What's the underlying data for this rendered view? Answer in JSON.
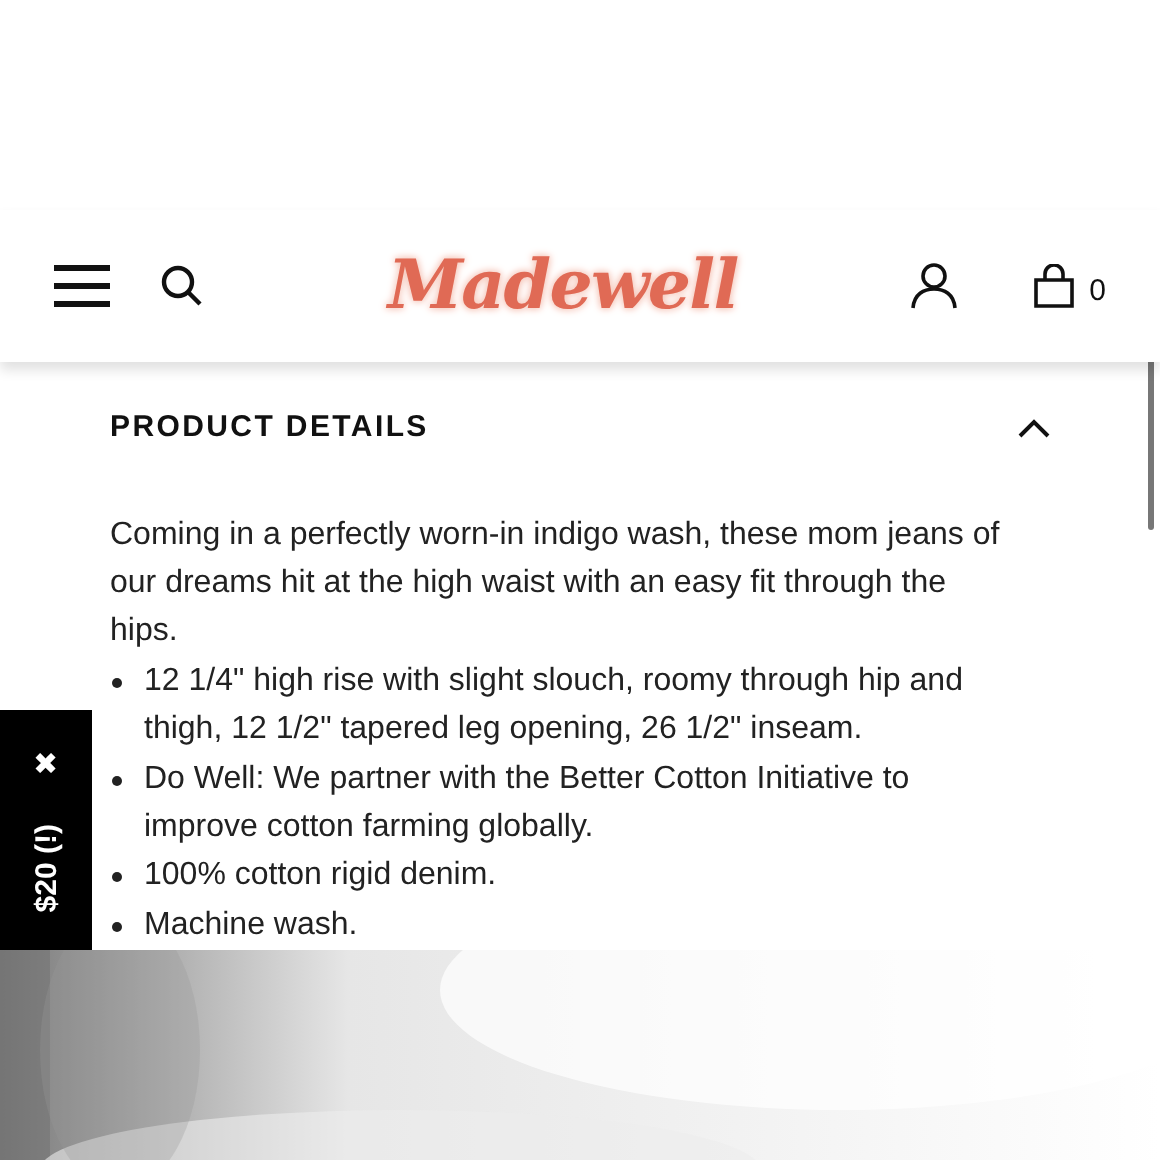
{
  "header": {
    "logo": "Madewell",
    "cart_count": "0"
  },
  "section": {
    "title": "PRODUCT DETAILS",
    "expanded": true,
    "description": "Coming in a perfectly worn-in indigo wash, these mom jeans of our dreams hit at the high waist with an easy fit through the hips.",
    "bullets": [
      "12 1/4\" high rise with slight slouch, roomy through hip and thigh, 12 1/2\" tapered leg opening, 26 1/2\" inseam.",
      "Do Well: We partner with the Better Cotton Initiative to improve cotton farming globally.",
      "100% cotton rigid denim.",
      "Machine wash."
    ]
  },
  "promo_tab": {
    "close": "✖",
    "label": "$20 (!)"
  }
}
